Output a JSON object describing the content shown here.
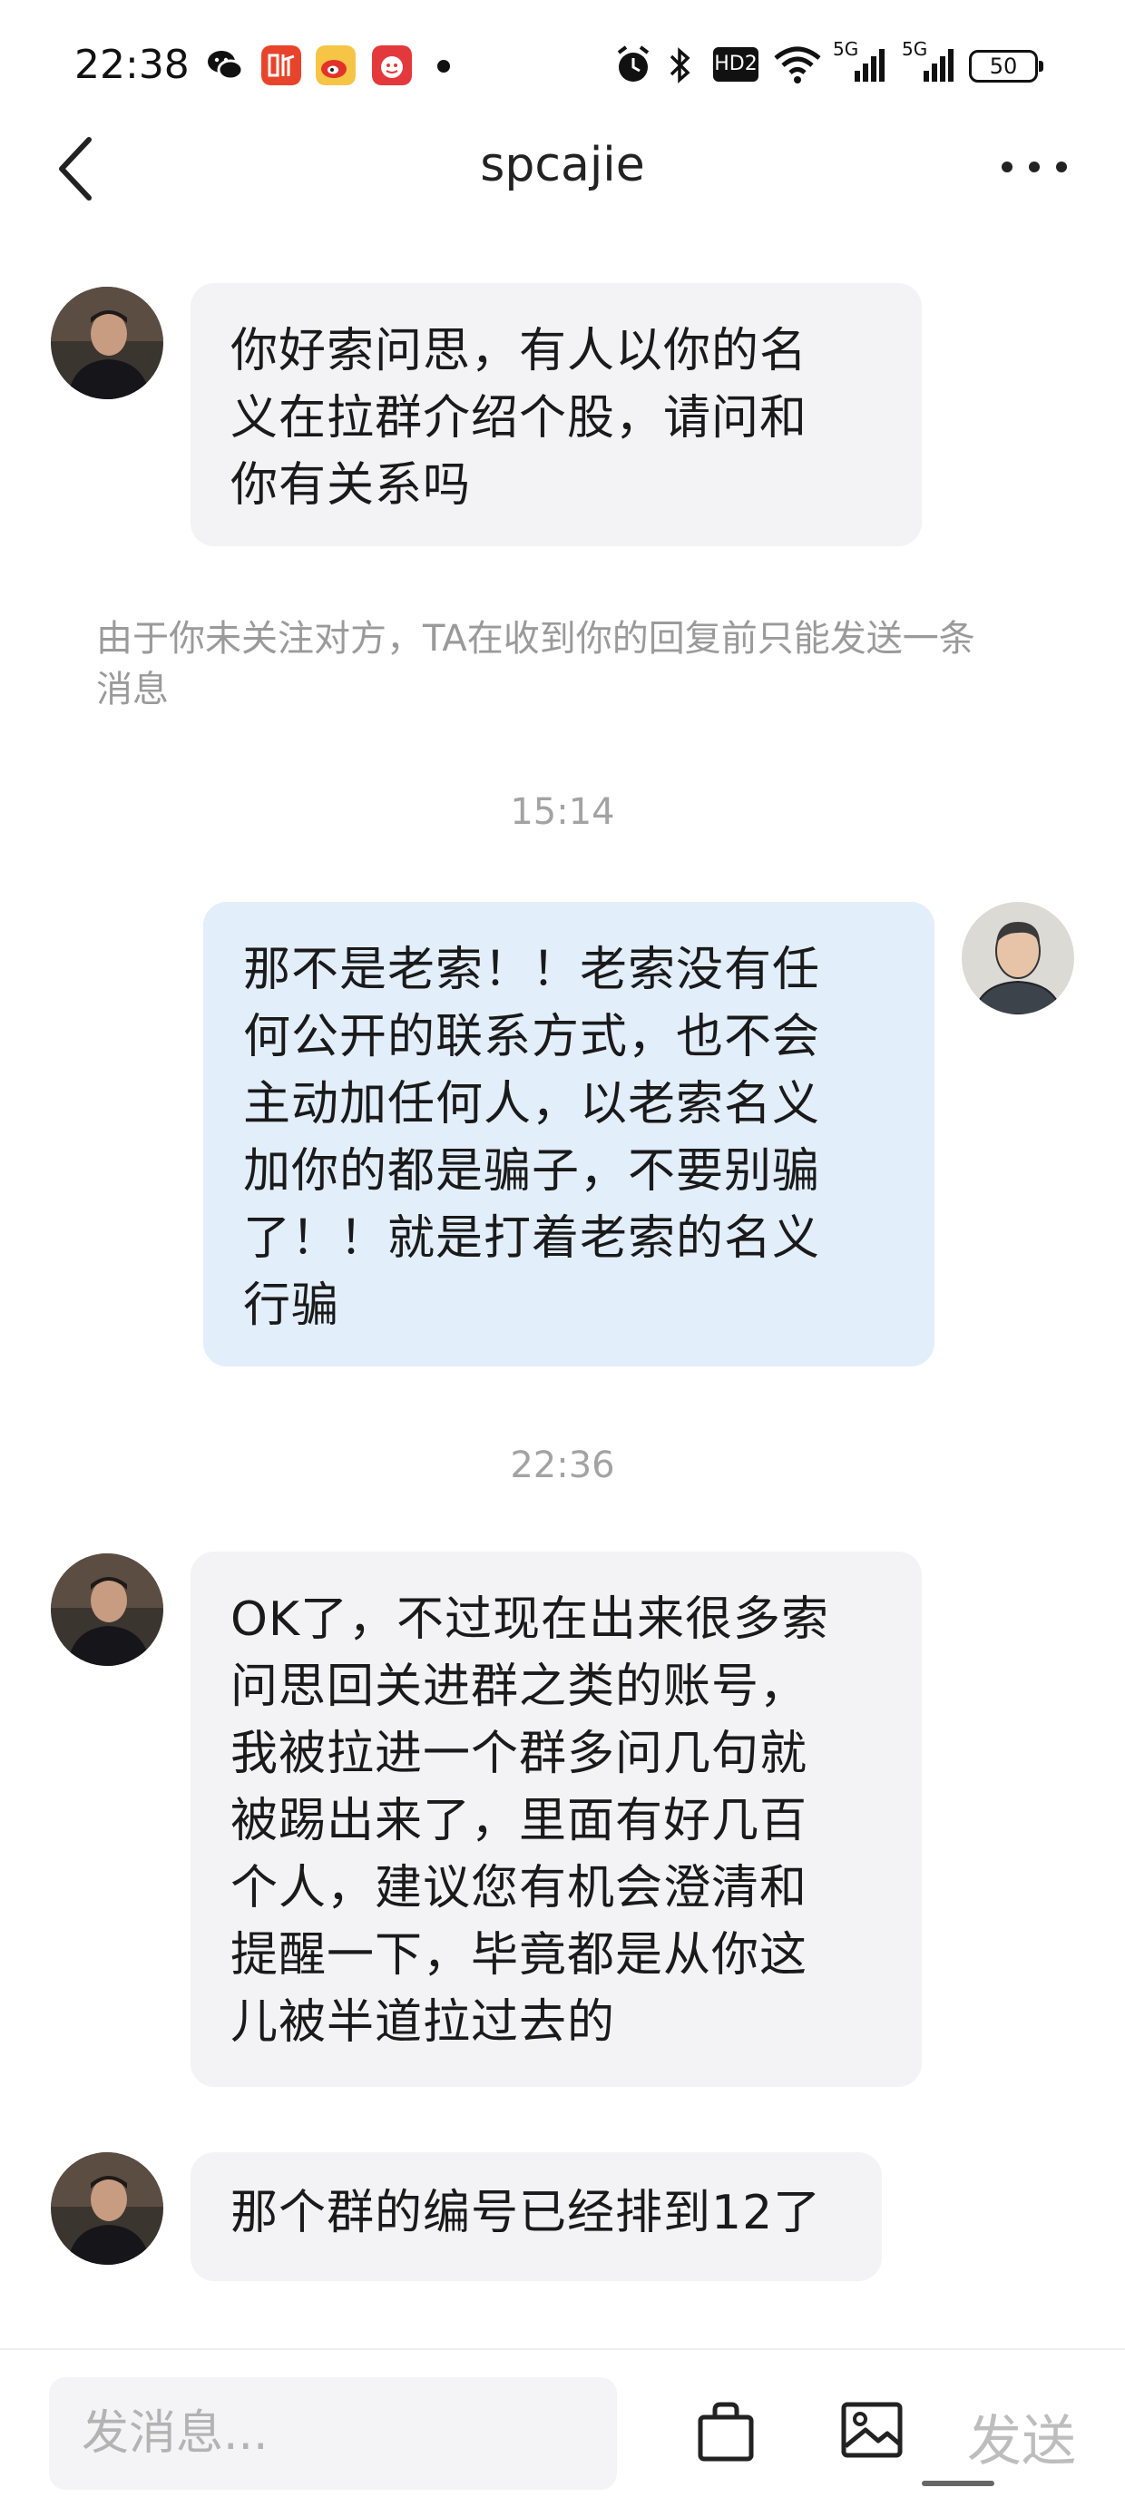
{
  "status_bar": {
    "time": "22:38",
    "app_icons": [
      "wechat-icon",
      "ting-app-icon",
      "weibo-icon",
      "app-icon"
    ],
    "hd_label": "HD2",
    "signal_labels": [
      "5G",
      "5G"
    ],
    "battery": "50"
  },
  "header": {
    "title": "spcajie"
  },
  "messages": [
    {
      "text": "你好索问思，有人以你的名\n义在拉群介绍个股，请问和\n你有关系吗"
    },
    {
      "notice": "由于你未关注对方，TA在收到你的回复前只能发送一条\n消息"
    },
    {
      "timestamp": "15:14"
    },
    {
      "text": "那不是老索！！老索没有任\n何公开的联系方式，也不会\n主动加任何人，以老索名义\n加你的都是骗子，不要别骗\n了！！就是打着老索的名义\n行骗"
    },
    {
      "timestamp": "22:36"
    },
    {
      "text": "OK了，不过现在出来很多索\n问思回关进群之类的账号，\n我被拉进一个群多问几句就\n被踢出来了，里面有好几百\n个人，建议您有机会澄清和\n提醒一下，毕竟都是从你这\n儿被半道拉过去的"
    },
    {
      "text": "那个群的编号已经排到12了"
    }
  ],
  "input_bar": {
    "placeholder": "发消息...",
    "send_label": "发送"
  },
  "colors": {
    "incoming_bubble": "#f3f3f5",
    "outgoing_bubble": "#e3eefb",
    "muted_text": "#9a9a9a"
  }
}
